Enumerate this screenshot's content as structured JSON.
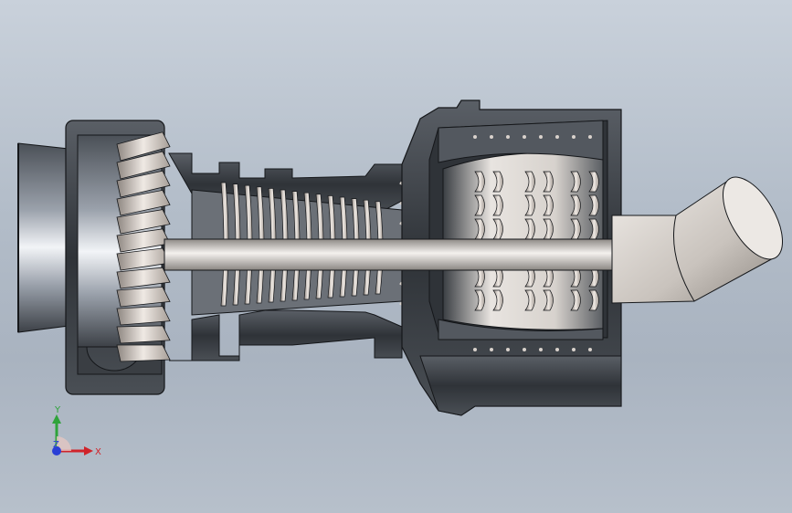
{
  "viewport": {
    "background_top": "#c9d1db",
    "background_bottom": "#a9b3c0"
  },
  "model": {
    "body_color": "#3f4349",
    "blade_color": "#d9d2cc",
    "shaft_color": "#cfcac6",
    "edge_color": "#15171a"
  },
  "triad": {
    "x_label": "X",
    "y_label": "Y",
    "z_label": "Z",
    "x_color": "#d0232a",
    "y_color": "#2fa33a",
    "z_color": "#2a3fd6"
  }
}
